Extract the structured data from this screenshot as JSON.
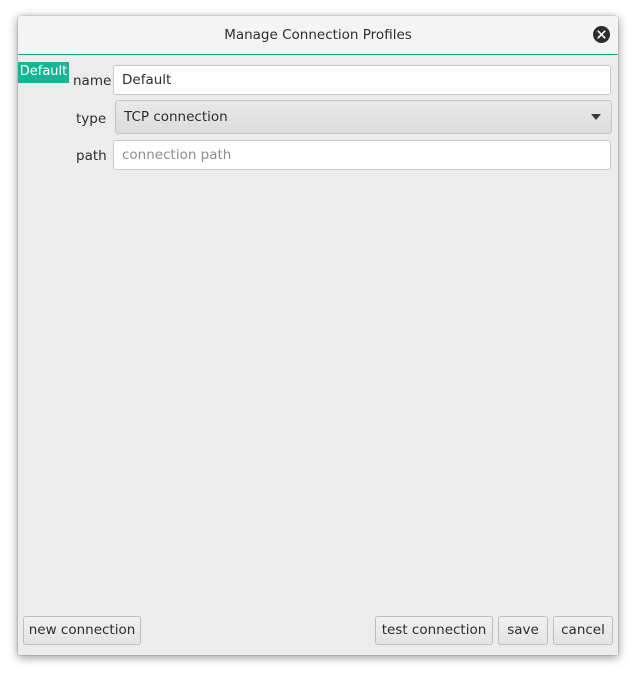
{
  "window": {
    "title": "Manage Connection Profiles"
  },
  "profiles": [
    {
      "label": "Default",
      "selected": true
    }
  ],
  "form": {
    "name_label": "name",
    "name_value": "Default",
    "type_label": "type",
    "type_value": "TCP connection",
    "path_label": "path",
    "path_value": "",
    "path_placeholder": "connection path"
  },
  "buttons": {
    "new_connection": "new connection",
    "test_connection": "test connection",
    "save": "save",
    "cancel": "cancel"
  },
  "colors": {
    "accent": "#17b596",
    "title_underline": "#17a48b",
    "window_bg": "#ececec"
  },
  "icons": {
    "close": "close-icon",
    "dropdown": "chevron-down-icon"
  }
}
